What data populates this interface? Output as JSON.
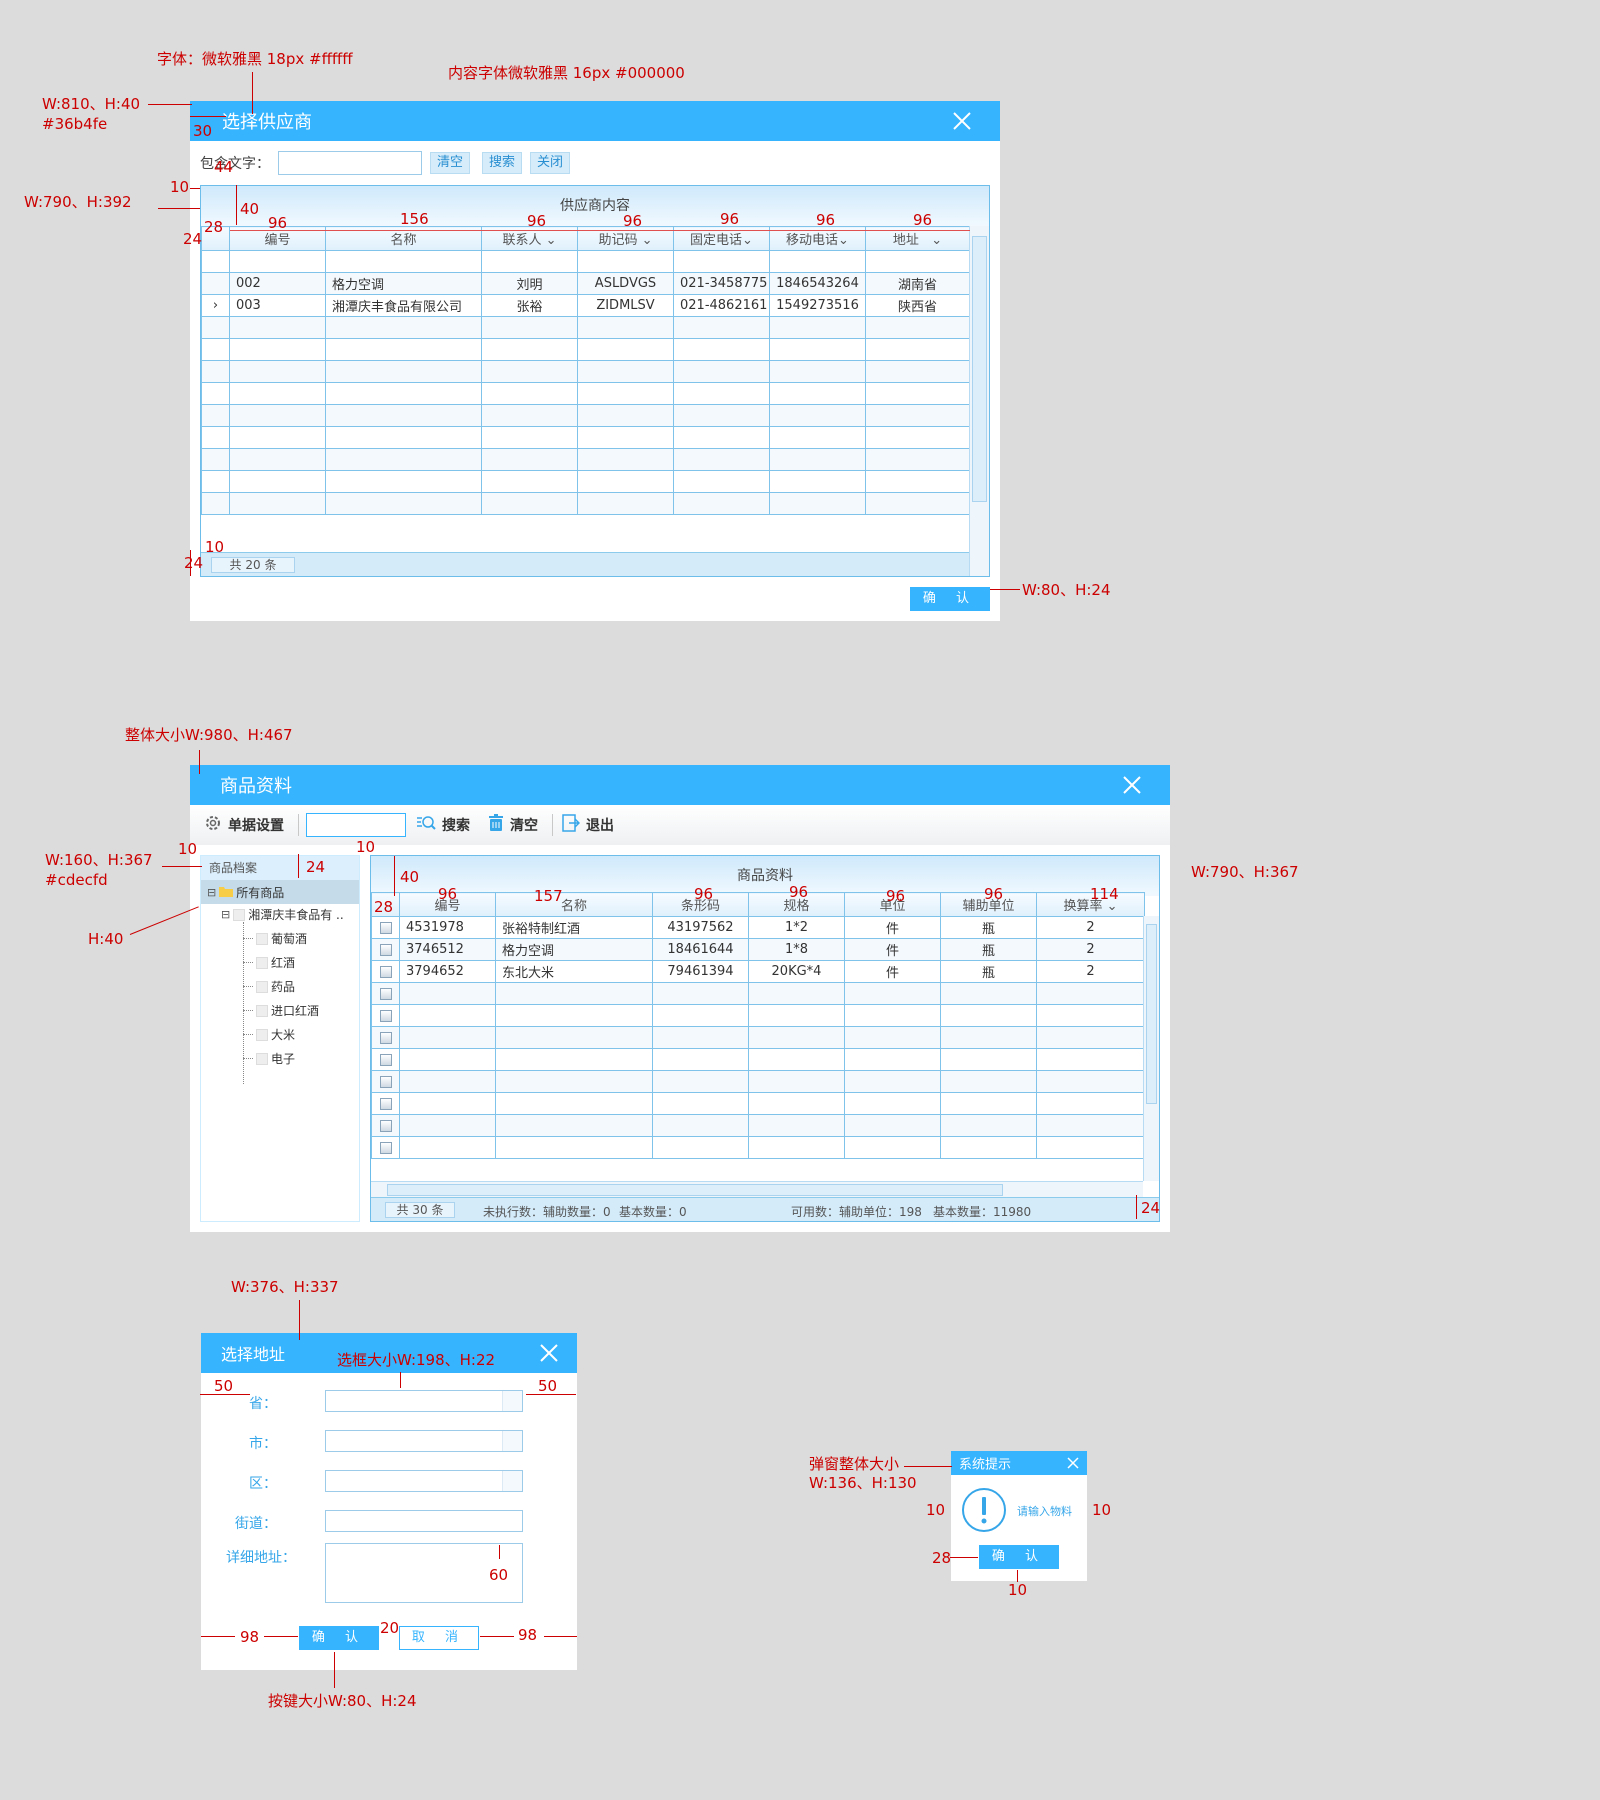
{
  "annotations": {
    "a1": "字体：微软雅黑 18px #ffffff",
    "a2": "内容字体微软雅黑 16px #000000",
    "a3": "W:810、H:40",
    "a4": "#36b4fe",
    "a5": "30",
    "a6": "10",
    "a7": "44",
    "a8": "W:790、H:392",
    "a9": "40",
    "a10": "28",
    "a11": "24",
    "a12": "10",
    "a13": "24",
    "a14": "W:80、H:24",
    "w1": "96",
    "w2": "156",
    "w3": "96",
    "w4": "96",
    "w5": "96",
    "w6": "96",
    "w7": "96",
    "b1": "整体大小W:980、H:467",
    "b2": "10",
    "b3": "24",
    "b4": "10",
    "b5": "W:160、H:367",
    "b6": "#cdecfd",
    "b7": "H:40",
    "b8": "40",
    "b9": "28",
    "b10": "W:790、H:367",
    "b11": "24",
    "bw1": "96",
    "bw2": "157",
    "bw3": "96",
    "bw4": "96",
    "bw5": "96",
    "bw6": "96",
    "bw7": "114",
    "c1": "W:376、H:337",
    "c2": "选框大小W:198、H:22",
    "c3": "50",
    "c4": "50",
    "c5": "60",
    "c6": "98",
    "c7": "20",
    "c8": "98",
    "c9": "按键大小W:80、H:24",
    "d1": "弹窗整体大小",
    "d2": "W:136、H:130",
    "d3": "10",
    "d4": "10",
    "d5": "28",
    "d6": "10"
  },
  "supplier_dialog": {
    "title": "选择供应商",
    "search_label": "包含文字：",
    "search_value": "",
    "btn_clear": "清空",
    "btn_search": "搜索",
    "btn_close": "关闭",
    "grid_caption": "供应商内容",
    "columns": [
      "编号",
      "名称",
      "联系人",
      "助记码",
      "固定电话",
      "移动电话",
      "地址"
    ],
    "rows": [
      [
        "",
        "",
        "",
        "",
        "",
        "",
        ""
      ],
      [
        "002",
        "格力空调",
        "刘明",
        "ASLDVGS",
        "021-3458775",
        "1846543264",
        "湖南省"
      ],
      [
        "003",
        "湘潭庆丰食品有限公司",
        "张裕",
        "ZIDMLSV",
        "021-4862161",
        "1549273516",
        "陕西省"
      ]
    ],
    "current_row_marker": "›",
    "total": "共 20 条",
    "confirm": "确 认"
  },
  "goods_dialog": {
    "title": "商品资料",
    "toolbar": {
      "settings": "单据设置",
      "search": "搜索",
      "clear": "清空",
      "exit": "退出",
      "search_value": ""
    },
    "tree": {
      "header": "商品档案",
      "root": "所有商品",
      "child": "湘潭庆丰食品有 ..",
      "leaves": [
        "葡萄酒",
        "红酒",
        "药品",
        "进口红酒",
        "大米",
        "电子"
      ]
    },
    "grid_caption": "商品资料",
    "columns": [
      "编号",
      "名称",
      "条形码",
      "规格",
      "单位",
      "辅助单位",
      "换算率"
    ],
    "rows": [
      [
        "4531978",
        "张裕特制红酒",
        "43197562",
        "1*2",
        "件",
        "瓶",
        "2"
      ],
      [
        "3746512",
        "格力空调",
        "18461644",
        "1*8",
        "件",
        "瓶",
        "2"
      ],
      [
        "3794652",
        "东北大米",
        "79461394",
        "20KG*4",
        "件",
        "瓶",
        "2"
      ]
    ],
    "footer": {
      "total": "共 30 条",
      "unexec": "未执行数：辅助数量：0",
      "base": "基本数量：0",
      "avail": "可用数：辅助单位：198",
      "base2": "基本数量：11980"
    }
  },
  "address_dialog": {
    "title": "选择地址",
    "labels": {
      "province": "省：",
      "city": "市：",
      "district": "区：",
      "street": "街道：",
      "detail": "详细地址："
    },
    "confirm": "确 认",
    "cancel": "取 消"
  },
  "alert_dialog": {
    "title": "系统提示",
    "message": "请输入物料",
    "confirm": "确 认"
  },
  "colors": {
    "titlebar": "#36b4fe",
    "tree_border": "#cdecfd",
    "annotation": "#cc0000"
  }
}
